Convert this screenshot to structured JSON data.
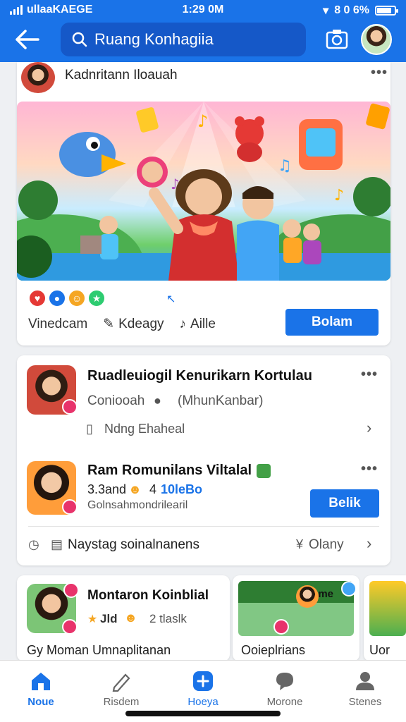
{
  "status_bar": {
    "carrier": "ullaaKAEGE",
    "time": "1:29 0M",
    "battery": "8 0 6%"
  },
  "header": {
    "search_text": "Ruang Konhagiia",
    "icons": [
      "back-arrow-icon",
      "search-icon",
      "camera-icon",
      "profile-avatar"
    ]
  },
  "post": {
    "author": "Kadnritann Iloauah",
    "reactions": [
      "heart",
      "like",
      "wow",
      "star"
    ],
    "actions": [
      {
        "label": "Vinedcam",
        "icon": ""
      },
      {
        "label": "Kdeagy",
        "icon": "edit-icon"
      },
      {
        "label": "Aille",
        "icon": "music-icon"
      }
    ],
    "button": "Bolam"
  },
  "group_card": {
    "item1": {
      "title": "Ruadleuiogil Kenurikarn Kortulau",
      "subtitle_left": "Coniooah",
      "subtitle_right": "(MhunKanbar)",
      "info": "Ndng Ehaheal"
    },
    "item2": {
      "title": "Ram Romunilans Viltalal",
      "meta_left": "3.3and",
      "meta_num": "4",
      "meta_link": "10leBo",
      "subtitle": "Golnsahmondrilearil",
      "button": "Belik"
    },
    "footer": {
      "left": "Naystag soinalnanens",
      "right": "Olany"
    }
  },
  "tiles": [
    {
      "title": "Montaron Koinblial",
      "meta": "Jld",
      "meta2": "2 tlaslk",
      "footer": "Gy  Moman Umnaplitanan"
    },
    {
      "overlay": "mme",
      "footer": "Ooieplrians"
    },
    {
      "footer": "Uor"
    }
  ],
  "bottom_nav": [
    {
      "label": "Noue",
      "icon": "home-icon",
      "active": true
    },
    {
      "label": "Risdem",
      "icon": "pen-icon",
      "active": false
    },
    {
      "label": "Hoeya",
      "icon": "plus-icon",
      "active": false
    },
    {
      "label": "Morone",
      "icon": "chat-icon",
      "active": false
    },
    {
      "label": "Stenes",
      "icon": "person-icon",
      "active": false
    }
  ],
  "colors": {
    "primary": "#1a73e8",
    "search_bg": "#1558c8",
    "badge": "#e8336b"
  }
}
